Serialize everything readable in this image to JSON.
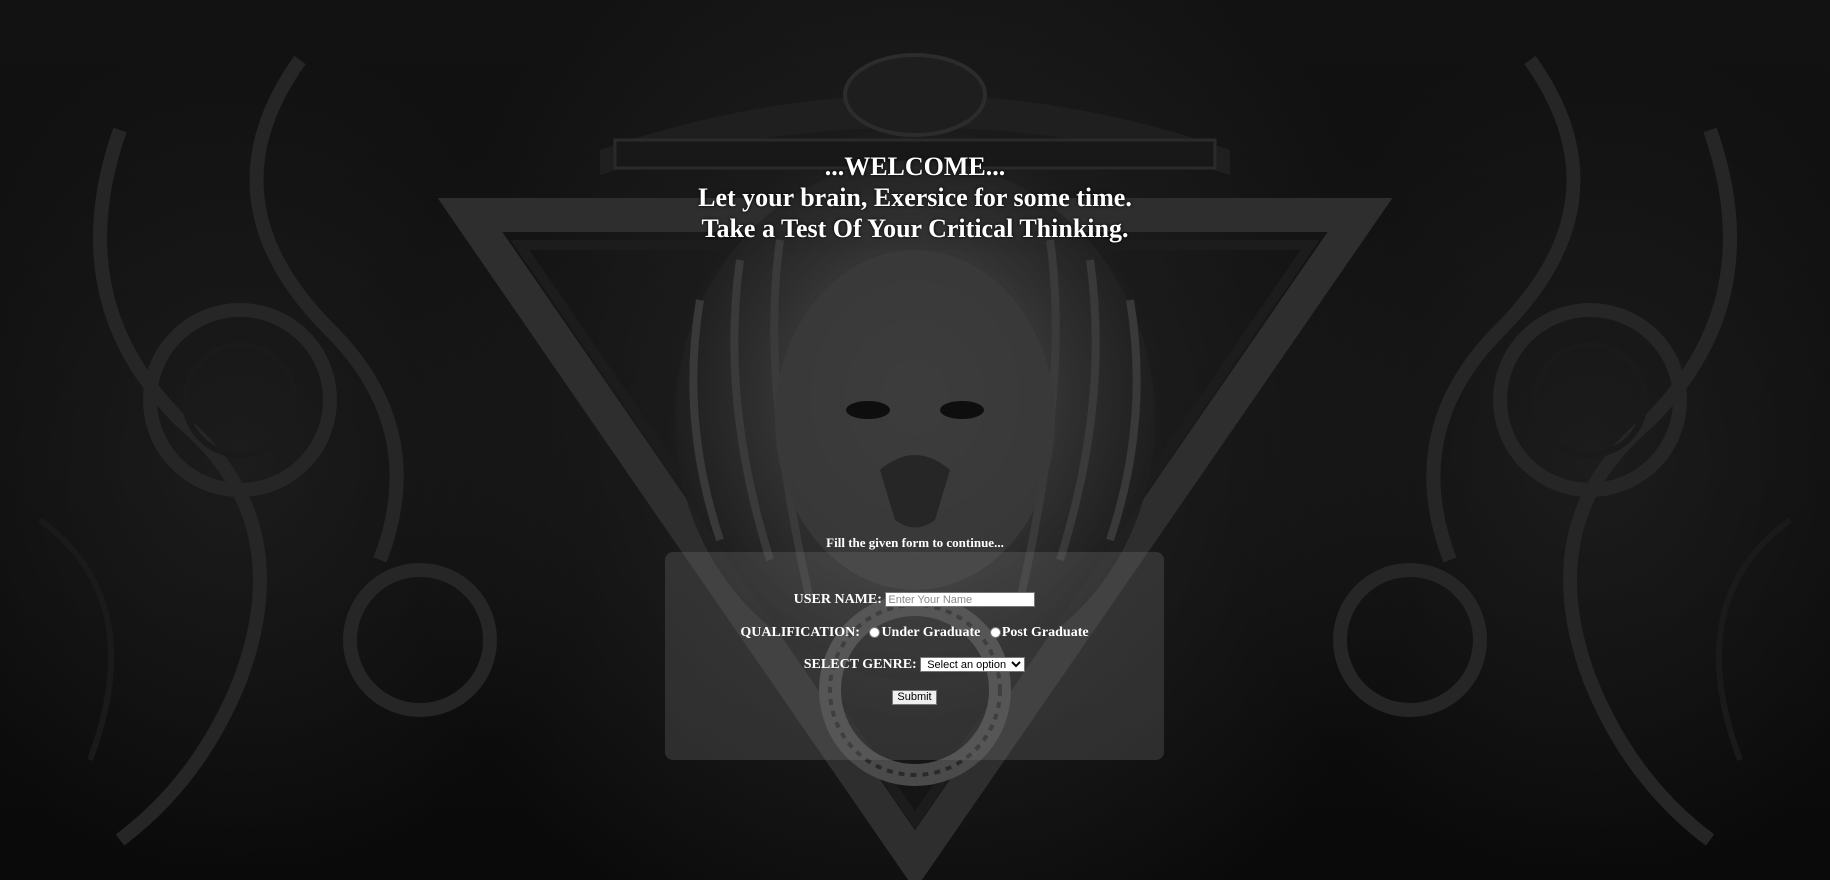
{
  "heading": {
    "line1": "...WELCOME...",
    "line2": "Let your brain, Exersice for some time.",
    "line3": "Take a Test Of Your Critical Thinking."
  },
  "form_hint": "Fill the given form to continue...",
  "form": {
    "username_label": "USER NAME:",
    "username_placeholder": "Enter Your Name",
    "username_value": "",
    "qualification_label": "QUALIFICATION:",
    "qualification_options": [
      "Under Graduate",
      "Post Graduate"
    ],
    "genre_label": "SELECT GENRE:",
    "genre_selected": "Select an option",
    "submit_label": "Submit"
  },
  "background": {
    "description_icon": "lion-emblem-artwork",
    "base_color": "#0b0b0b"
  }
}
